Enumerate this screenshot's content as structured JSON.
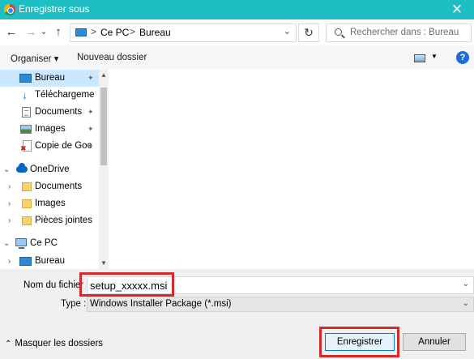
{
  "window": {
    "title": "Enregistrer sous",
    "close_glyph": "✕"
  },
  "nav": {
    "back_glyph": "←",
    "forward_glyph": "→",
    "recent_glyph": "⌄",
    "up_glyph": "↑",
    "breadcrumb": [
      "Ce PC",
      "Bureau"
    ],
    "breadcrumb_sep": ">",
    "dropdown_glyph": "⌄",
    "refresh_glyph": "↻",
    "search_placeholder": "Rechercher dans : Bureau"
  },
  "toolbar": {
    "organize_label": "Organiser ▾",
    "new_folder_label": "Nouveau dossier",
    "view_dd_glyph": "▼",
    "help_glyph": "?"
  },
  "sidebar": {
    "items": [
      {
        "label": "Bureau",
        "icon": "desktop-icon",
        "pinned": true,
        "selected": true
      },
      {
        "label": "Téléchargeme",
        "icon": "download-icon",
        "pinned": true
      },
      {
        "label": "Documents",
        "icon": "documents-icon",
        "pinned": true
      },
      {
        "label": "Images",
        "icon": "images-icon",
        "pinned": true
      },
      {
        "label": "Copie de Goc",
        "icon": "file-icon",
        "pinned": true
      },
      {
        "label": "OneDrive",
        "icon": "cloud-icon",
        "expanded": true
      },
      {
        "label": "Documents",
        "icon": "folder-icon"
      },
      {
        "label": "Images",
        "icon": "folder-icon"
      },
      {
        "label": "Pièces jointes",
        "icon": "folder-icon"
      },
      {
        "label": "Ce PC",
        "icon": "pc-icon",
        "expanded": true
      },
      {
        "label": "Bureau",
        "icon": "desktop-icon"
      }
    ],
    "pin_glyph": "✦",
    "chev_collapsed": "›",
    "chev_expanded": "⌄",
    "scroll_up": "▲",
    "scroll_down": "▼"
  },
  "form": {
    "filename_label": "Nom du fichier :",
    "filename_value": "setup_xxxxx.msi",
    "type_label": "Type :",
    "type_value": "Windows Installer Package (*.msi)",
    "dropdown_glyph": "⌄"
  },
  "footer": {
    "hide_folders_caret": "⌃",
    "hide_folders_label": "Masquer les dossiers",
    "save_label": "Enregistrer",
    "cancel_label": "Annuler"
  },
  "colors": {
    "titlebar": "#1dbfc4",
    "selection": "#cce8ff",
    "highlight": "#d42a2a",
    "accent": "#0078d7"
  }
}
